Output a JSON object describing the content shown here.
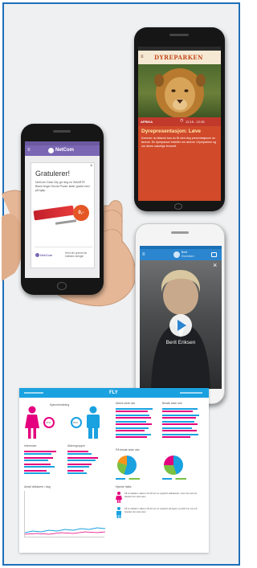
{
  "zoo_app": {
    "logo": "DYREPARKEN",
    "tag": "AFRIKA",
    "time": "12:15 - 12:35",
    "title": "Dyrepresentasjon: Løve",
    "body": "Kommer du tidsnok kan du få med deg presentasjonen av løvene. En dyrepasser forteller om løvene i Dyreparken og om deres naturlige levesett."
  },
  "netcom_app": {
    "brand": "NetCom",
    "heading": "Gratulerer!",
    "message": "NetCom Data City gir deg en SMARTE Black Angel Social Power lader gratis med på kjøp.",
    "bubble": "0,-",
    "close_glyph": "×",
    "footer_brand": "NetCom",
    "footer_text": "Hent din premie før butikken stenger"
  },
  "video_app": {
    "top_name": "Berit",
    "top_sub": "Svendsen",
    "caption": "Berit Eriksen",
    "close_glyph": "×"
  },
  "dashboard": {
    "header_title": "FLY",
    "gender_title": "Kjønnsfordeling",
    "female_pct": "47%",
    "male_pct": "53%",
    "interests_title": "Interesser",
    "age_title": "Aldersgrupper",
    "active_title": "Aktive siste uke",
    "visits_title": "Besøk siste uke",
    "os_title": "På besøk siste uke",
    "news_title": "Nyeste fakta",
    "daily_title": "Antall deltakere i dag",
    "fact1": "På en deltaker i alderen 15-18 som er registrert deltakende, mens han selv har plassert den siste uken",
    "fact2": "På en deltaker i alderen 30-40 som er registrert på appen og forblir her som på besøket den siste uken",
    "colors": {
      "blue": "#1aa1e0",
      "pink": "#e4007e",
      "green": "#7ac143",
      "orange": "#f7941d"
    }
  }
}
